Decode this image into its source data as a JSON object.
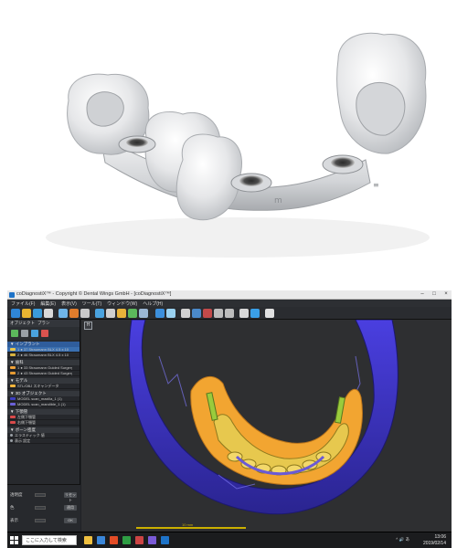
{
  "window": {
    "title": "coDiagnostiX™ - Copyright © Dental Wings GmbH - [coDiagnostiX™]"
  },
  "menu": [
    "ファイル(F)",
    "編集(E)",
    "表示(V)",
    "ツール(T)",
    "ウィンドウ(W)",
    "ヘルプ(H)"
  ],
  "left_panel": {
    "tabs": [
      "オブジェクト",
      "プラン"
    ],
    "sections": [
      {
        "title": "▼ インプラント",
        "rows": [
          {
            "text": "1 ● 37 Straumann BLX 4.5 x 10",
            "color": "#e7c84e"
          },
          {
            "text": "2 ● 46 Straumann BLX 4.5 x 10",
            "color": "#d9b340"
          }
        ]
      },
      {
        "title": "▼ 歯科",
        "rows": [
          {
            "text": "1 ● 33 Straumann Guided Surgery",
            "color": "#f0a33a"
          },
          {
            "text": "2 ● 43 Straumann Guided Surgery",
            "color": "#e59a32"
          }
        ]
      },
      {
        "title": "▼ モデル",
        "rows": [
          {
            "text": "STL/OBJ スキャンデータ",
            "color": "#f6b53c"
          }
        ]
      },
      {
        "title": "▼ 3D オブジェクト",
        "rows": [
          {
            "text": "MODEL scan_maxilla_1 (1)",
            "color": "#3d3fc2"
          },
          {
            "text": "MODEL scan_mandible_1 (1)",
            "color": "#6b61d9"
          }
        ]
      },
      {
        "title": "▼ 下顎管",
        "rows": [
          {
            "text": "左側下顎管",
            "color": "#d94a4a"
          },
          {
            "text": "右側下顎管",
            "color": "#d94a4a"
          }
        ]
      },
      {
        "title": "▼ ボーン密度",
        "rows": [
          {
            "text": "エラスティック 値",
            "color": "#9aa0a6"
          },
          {
            "text": "表示 設定",
            "color": "#9aa0a6"
          }
        ]
      }
    ],
    "controls": [
      {
        "label": "透明度",
        "button": "リセット"
      },
      {
        "label": "色",
        "button": "適用"
      },
      {
        "label": "表示",
        "button": "OK"
      }
    ]
  },
  "viewport": {
    "view_icon": "H",
    "scale_label": "10 mm"
  },
  "taskbar": {
    "search_placeholder": "ここに入力して検索",
    "tray_text": "^ 🔊 あ",
    "time": "13:06",
    "date": "2019/02/14",
    "colors": {
      "start": "#ffffff",
      "apps": [
        "#f0c040",
        "#3a86d9",
        "#e34c26",
        "#2f9e44",
        "#cc4444",
        "#7a5ad6",
        "#1e73c8"
      ]
    }
  }
}
